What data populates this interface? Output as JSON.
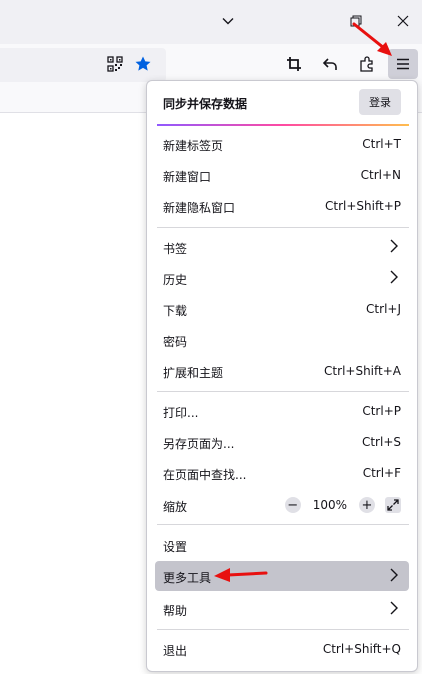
{
  "menu": {
    "sync": {
      "title": "同步并保存数据",
      "signin": "登录"
    },
    "items": [
      {
        "label": "新建标签页",
        "shortcut": "Ctrl+T"
      },
      {
        "label": "新建窗口",
        "shortcut": "Ctrl+N"
      },
      {
        "label": "新建隐私窗口",
        "shortcut": "Ctrl+Shift+P"
      },
      {
        "label": "书签"
      },
      {
        "label": "历史"
      },
      {
        "label": "下载",
        "shortcut": "Ctrl+J"
      },
      {
        "label": "密码"
      },
      {
        "label": "扩展和主题",
        "shortcut": "Ctrl+Shift+A"
      },
      {
        "label": "打印...",
        "shortcut": "Ctrl+P"
      },
      {
        "label": "另存页面为...",
        "shortcut": "Ctrl+S"
      },
      {
        "label": "在页面中查找...",
        "shortcut": "Ctrl+F"
      },
      {
        "label": "缩放"
      },
      {
        "label": "设置"
      },
      {
        "label": "更多工具"
      },
      {
        "label": "帮助"
      },
      {
        "label": "退出",
        "shortcut": "Ctrl+Shift+Q"
      }
    ],
    "zoom": {
      "value": "100%",
      "minus": "−",
      "plus": "+"
    }
  },
  "icons": {
    "bookmark_star_color": "#0061e0",
    "annotation_arrow_color": "#e8100f"
  }
}
